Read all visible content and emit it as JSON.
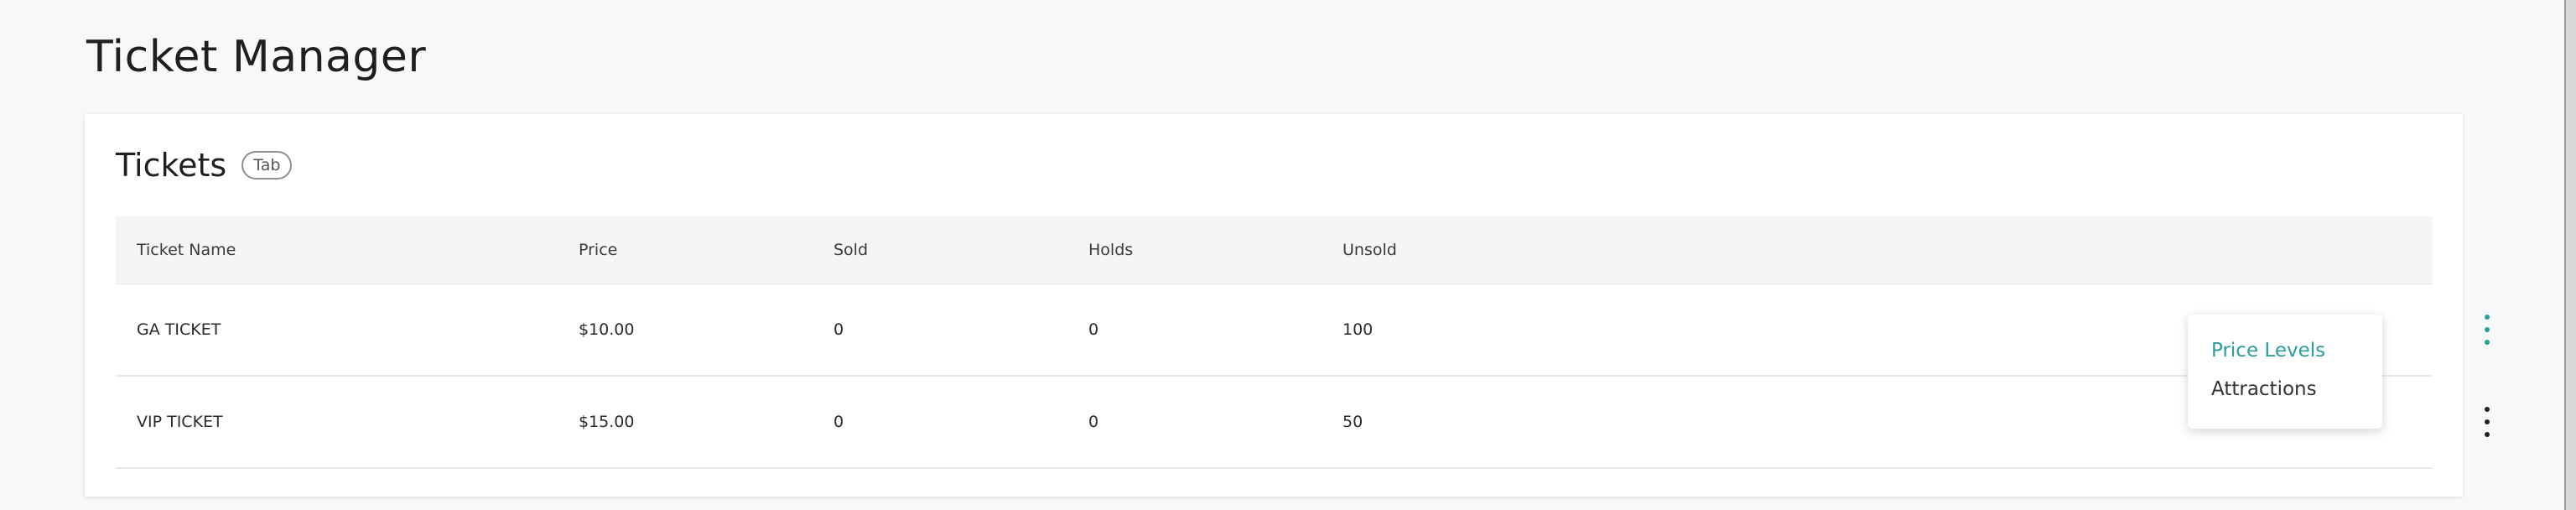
{
  "page": {
    "title": "Ticket Manager"
  },
  "card": {
    "title": "Tickets",
    "chip": "Tab"
  },
  "table": {
    "columns": [
      "Ticket Name",
      "Price",
      "Sold",
      "Holds",
      "Unsold"
    ],
    "rows": [
      {
        "name": "GA TICKET",
        "price": "$10.00",
        "sold": "0",
        "holds": "0",
        "unsold": "100"
      },
      {
        "name": "VIP TICKET",
        "price": "$15.00",
        "sold": "0",
        "holds": "0",
        "unsold": "50"
      }
    ]
  },
  "menu": {
    "items": [
      "Price Levels",
      "Attractions"
    ],
    "active_color": "#2a9d9d"
  },
  "icons": {
    "row_actions": [
      "calendar-icon",
      "user-icon",
      "settings-icon"
    ],
    "more": "more-vertical-icon"
  }
}
